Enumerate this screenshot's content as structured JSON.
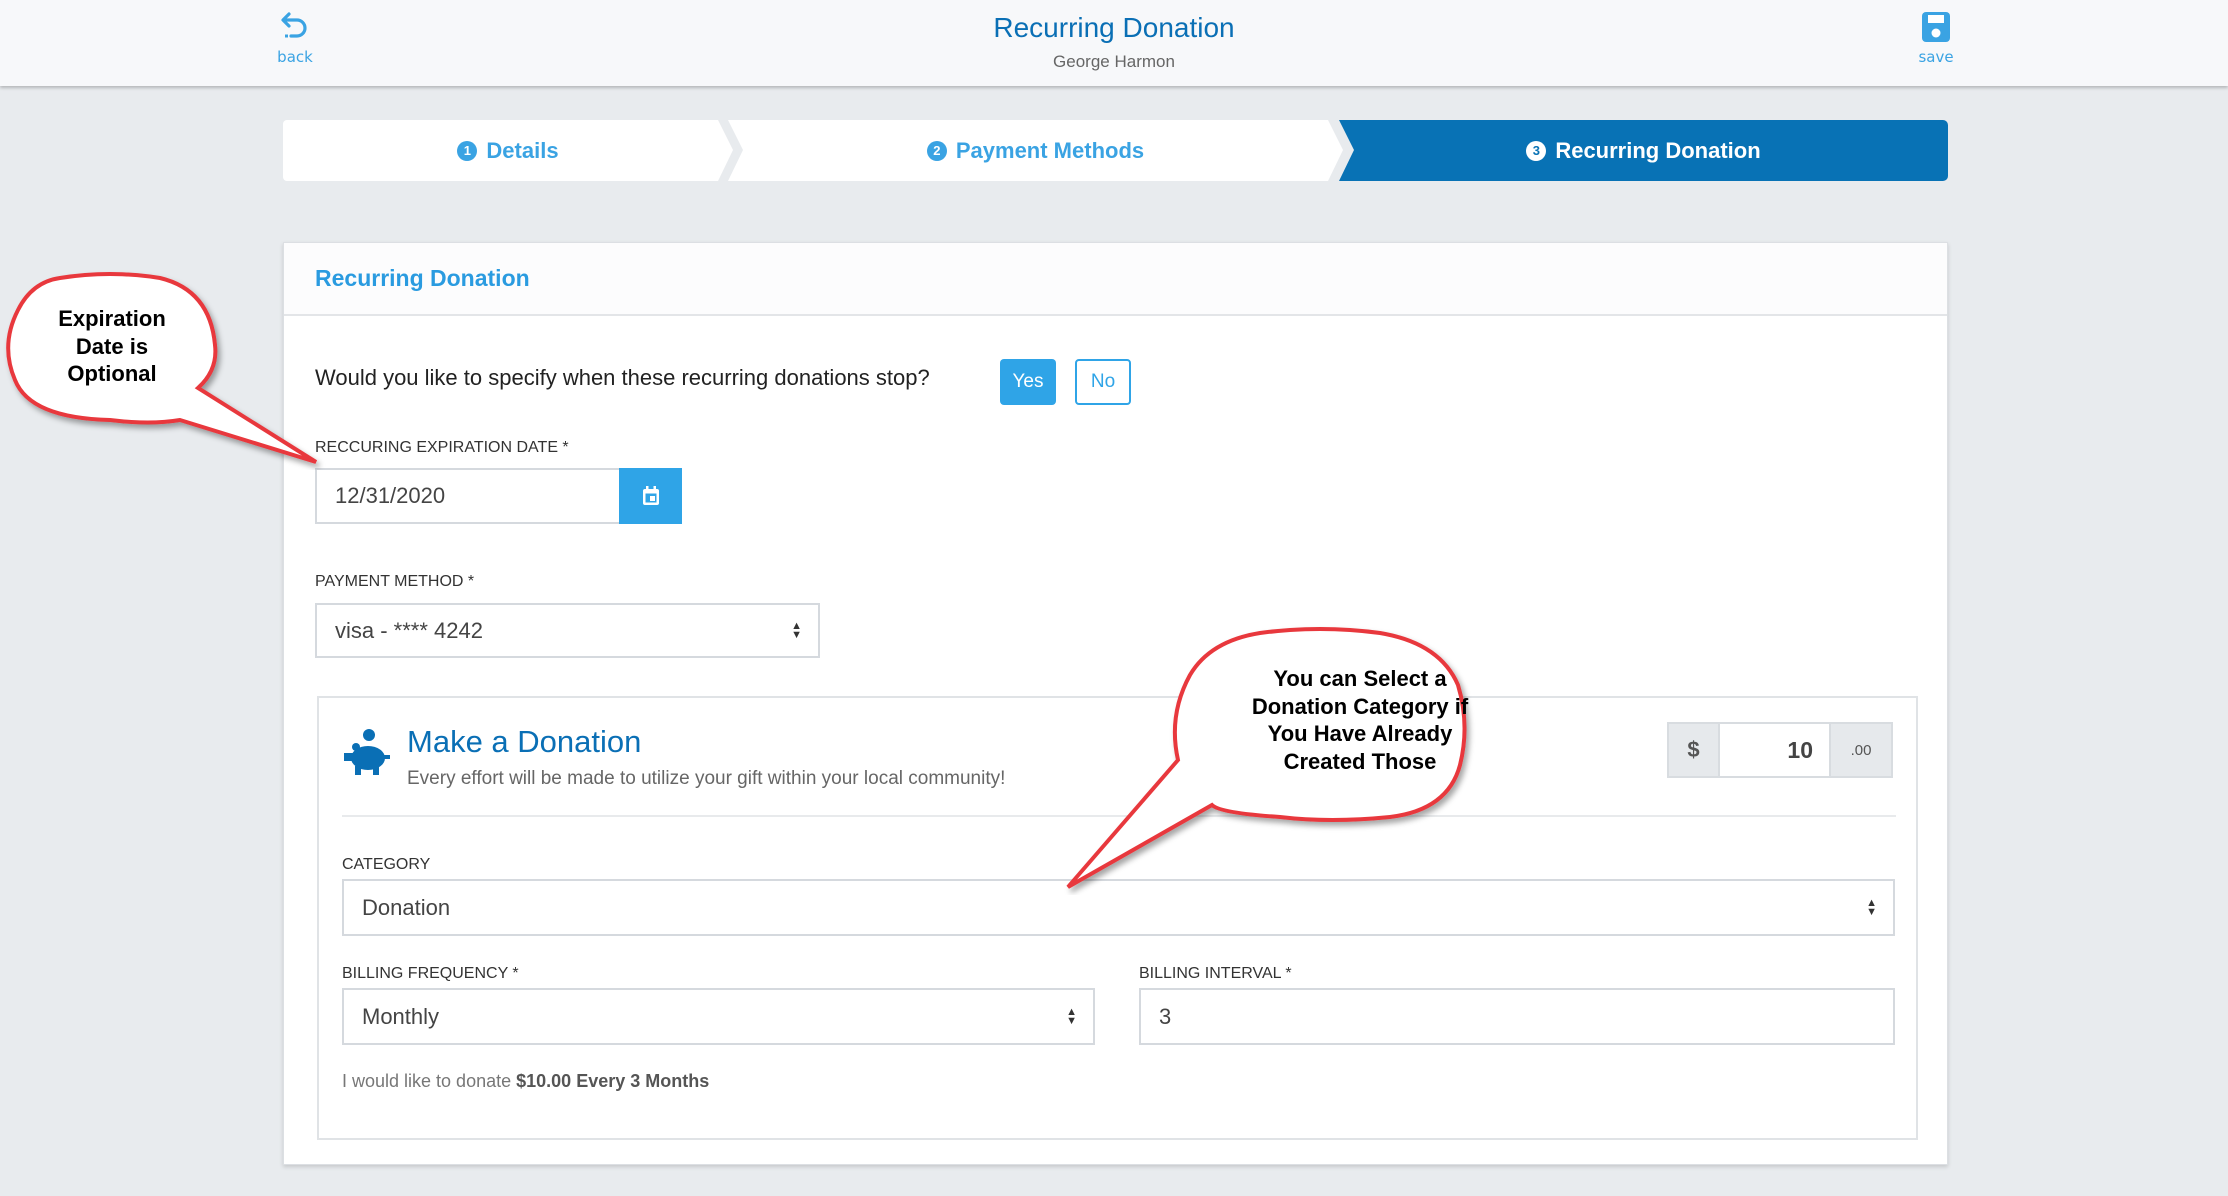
{
  "header": {
    "back_label": "back",
    "title": "Recurring Donation",
    "subtitle": "George Harmon",
    "save_label": "save"
  },
  "stepper": {
    "steps": [
      {
        "num": "1",
        "label": "Details",
        "active": false
      },
      {
        "num": "2",
        "label": "Payment Methods",
        "active": false
      },
      {
        "num": "3",
        "label": "Recurring Donation",
        "active": true
      }
    ]
  },
  "card": {
    "title": "Recurring Donation",
    "question": "Would you like to specify when these recurring donations stop?",
    "yes_label": "Yes",
    "no_label": "No",
    "expiration_label": "RECCURING EXPIRATION DATE *",
    "expiration_value": "12/31/2020",
    "payment_label": "PAYMENT METHOD *",
    "payment_value": "visa - **** 4242"
  },
  "donation": {
    "title": "Make a Donation",
    "subtitle": "Every effort will be made to utilize your gift within your local community!",
    "currency_symbol": "$",
    "amount": "10",
    "cents": ".00",
    "category_label": "CATEGORY",
    "category_value": "Donation",
    "frequency_label": "BILLING FREQUENCY *",
    "frequency_value": "Monthly",
    "interval_label": "BILLING INTERVAL *",
    "interval_value": "3",
    "summary_prefix": "I would like to donate",
    "summary_bold": "$10.00 Every 3 Months"
  },
  "annotations": {
    "callout_expiration": [
      "Expiration",
      "Date is",
      "Optional"
    ],
    "callout_category": [
      "You can Select a",
      "Donation Category if",
      "You Have Already",
      "Created Those"
    ]
  },
  "colors": {
    "primary": "#2fa4e7",
    "brand_dark": "#0872b5",
    "callout_border": "#e8383d"
  }
}
